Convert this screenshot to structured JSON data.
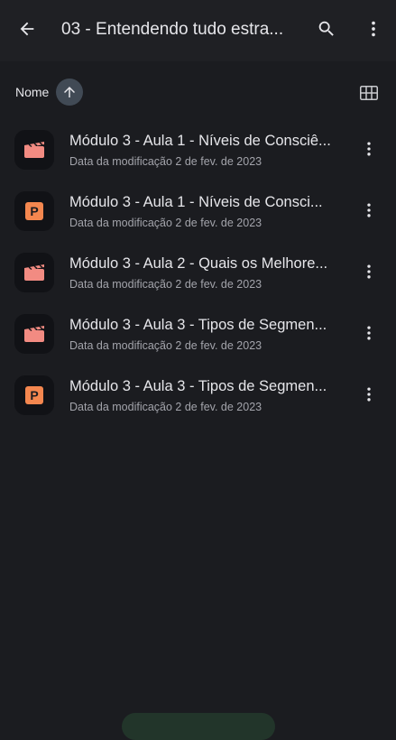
{
  "appbar": {
    "title": "03 - Entendendo tudo estra...",
    "back_icon": "arrow-back-icon",
    "search_icon": "search-icon",
    "more_icon": "more-vert-icon"
  },
  "sort": {
    "label": "Nome",
    "direction_icon": "arrow-up-icon",
    "view_icon": "grid-view-icon"
  },
  "files": [
    {
      "name": "Módulo 3 - Aula 1 - Níveis de Consciê...",
      "meta": "Data da modificação 2 de fev. de 2023",
      "type": "video",
      "icon": "video-clapper-icon"
    },
    {
      "name": "Módulo 3 - Aula 1 - Níveis de Consci...",
      "meta": "Data da modificação 2 de fev. de 2023",
      "type": "slides",
      "icon": "powerpoint-icon",
      "badge": "P"
    },
    {
      "name": "Módulo 3 - Aula 2 - Quais os Melhore...",
      "meta": "Data da modificação 2 de fev. de 2023",
      "type": "video",
      "icon": "video-clapper-icon"
    },
    {
      "name": "Módulo 3 - Aula 3 - Tipos de Segmen...",
      "meta": "Data da modificação 2 de fev. de 2023",
      "type": "video",
      "icon": "video-clapper-icon"
    },
    {
      "name": "Módulo 3 - Aula 3 - Tipos de Segmen...",
      "meta": "Data da modificação 2 de fev. de 2023",
      "type": "slides",
      "icon": "powerpoint-icon",
      "badge": "P"
    }
  ],
  "colors": {
    "background": "#1b1c20",
    "appbar": "#1f2024",
    "video_icon": "#f28b82",
    "slides_icon": "#f4874f",
    "sort_chip": "#414a55"
  }
}
